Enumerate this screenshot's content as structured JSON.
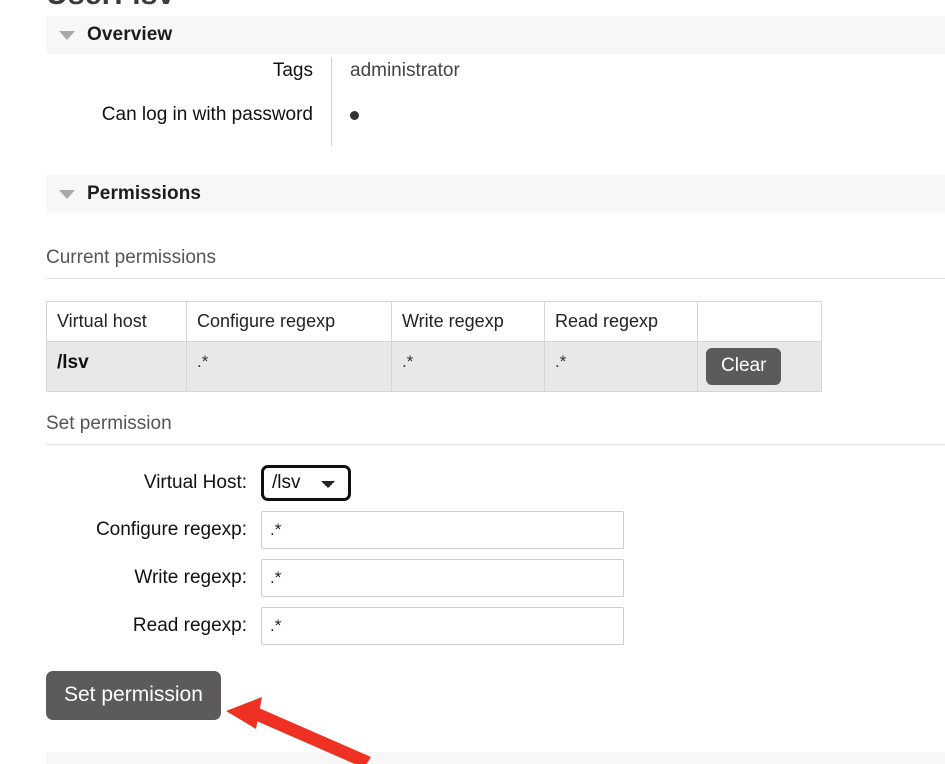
{
  "page": {
    "title": "User: lsv"
  },
  "sections": {
    "overview": {
      "label": "Overview",
      "rows": [
        {
          "label": "Tags",
          "value": "administrator"
        },
        {
          "label": "Can log in with password",
          "value": "●"
        }
      ]
    },
    "permissions": {
      "label": "Permissions",
      "current_heading": "Current permissions",
      "set_heading": "Set permission",
      "table": {
        "headers": [
          "Virtual host",
          "Configure regexp",
          "Write regexp",
          "Read regexp",
          ""
        ],
        "rows": [
          {
            "virtual_host": "/lsv",
            "configure_regexp": ".*",
            "write_regexp": ".*",
            "read_regexp": ".*",
            "action_label": "Clear"
          }
        ]
      },
      "form": {
        "virtual_host_label": "Virtual Host:",
        "virtual_host_value": "/lsv",
        "virtual_host_options": [
          "/lsv"
        ],
        "configure_label": "Configure regexp:",
        "configure_value": ".*",
        "write_label": "Write regexp:",
        "write_value": ".*",
        "read_label": "Read regexp:",
        "read_value": ".*",
        "submit_label": "Set permission"
      }
    }
  },
  "annotation": {
    "color": "#ef3124",
    "shape": "arrow-pointing-to-set-permission-button"
  }
}
